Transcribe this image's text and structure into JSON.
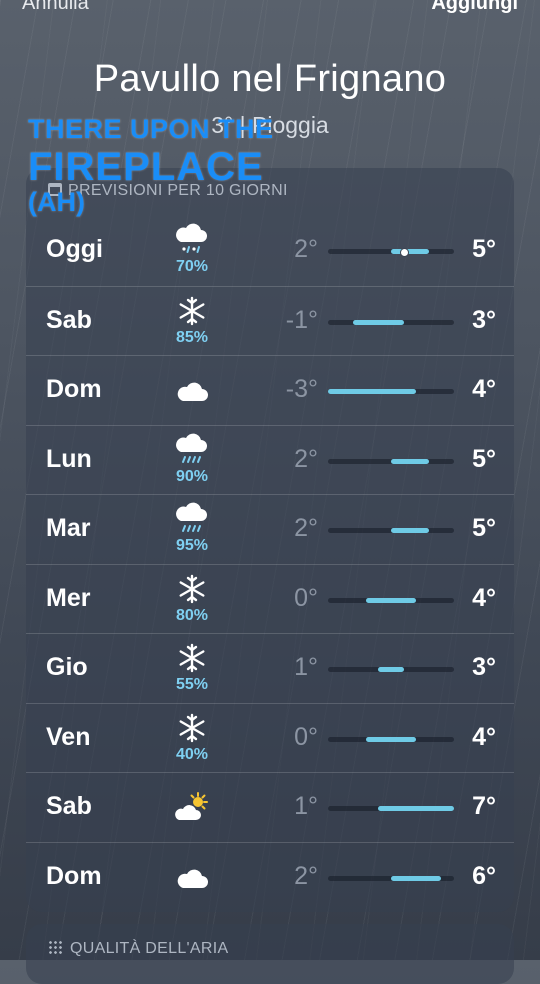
{
  "topbar": {
    "cancel_label": "Annulla",
    "add_label": "Aggiungi"
  },
  "location": {
    "name": "Pavullo nel Frignano",
    "condition": "3° | Pioggia"
  },
  "overlay": {
    "line1": "THERE UPON THE",
    "line2": "FIREPLACE",
    "line3": "(AH)"
  },
  "forecast": {
    "title": "PREVISIONI PER 10 GIORNI",
    "range_min": -3,
    "range_max": 7,
    "current_temp": 3,
    "days": [
      {
        "day": "Oggi",
        "icon": "snow-rain-icon",
        "pct": "70%",
        "low": "2°",
        "high": "5°",
        "low_val": 2,
        "high_val": 5
      },
      {
        "day": "Sab",
        "icon": "snowflake-icon",
        "pct": "85%",
        "low": "-1°",
        "high": "3°",
        "low_val": -1,
        "high_val": 3
      },
      {
        "day": "Dom",
        "icon": "cloud-icon",
        "pct": "",
        "low": "-3°",
        "high": "4°",
        "low_val": -3,
        "high_val": 4
      },
      {
        "day": "Lun",
        "icon": "rain-icon",
        "pct": "90%",
        "low": "2°",
        "high": "5°",
        "low_val": 2,
        "high_val": 5
      },
      {
        "day": "Mar",
        "icon": "rain-icon",
        "pct": "95%",
        "low": "2°",
        "high": "5°",
        "low_val": 2,
        "high_val": 5
      },
      {
        "day": "Mer",
        "icon": "snowflake-icon",
        "pct": "80%",
        "low": "0°",
        "high": "4°",
        "low_val": 0,
        "high_val": 4
      },
      {
        "day": "Gio",
        "icon": "snowflake-icon",
        "pct": "55%",
        "low": "1°",
        "high": "3°",
        "low_val": 1,
        "high_val": 3
      },
      {
        "day": "Ven",
        "icon": "snowflake-icon",
        "pct": "40%",
        "low": "0°",
        "high": "4°",
        "low_val": 0,
        "high_val": 4
      },
      {
        "day": "Sab",
        "icon": "partly-sunny-icon",
        "pct": "",
        "low": "1°",
        "high": "7°",
        "low_val": 1,
        "high_val": 7
      },
      {
        "day": "Dom",
        "icon": "cloud-icon",
        "pct": "",
        "low": "2°",
        "high": "6°",
        "low_val": 2,
        "high_val": 6
      }
    ]
  },
  "air_quality": {
    "title": "QUALITÀ DELL'ARIA"
  },
  "colors": {
    "accent_overlay": "#1a8df7",
    "precip": "#7fd0f2",
    "bar": "#6fcbe6"
  }
}
